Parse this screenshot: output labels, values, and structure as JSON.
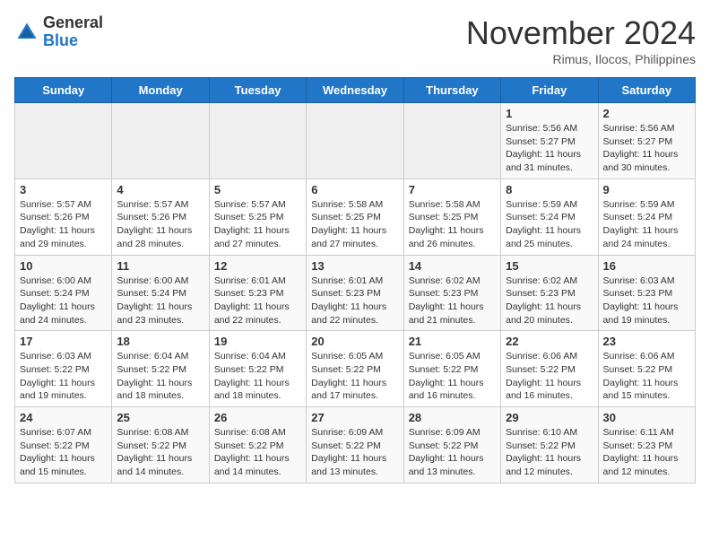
{
  "header": {
    "logo": {
      "general": "General",
      "blue": "Blue"
    },
    "month": "November 2024",
    "location": "Rimus, Ilocos, Philippines"
  },
  "weekdays": [
    "Sunday",
    "Monday",
    "Tuesday",
    "Wednesday",
    "Thursday",
    "Friday",
    "Saturday"
  ],
  "weeks": [
    [
      {
        "day": "",
        "sunrise": "",
        "sunset": "",
        "daylight": ""
      },
      {
        "day": "",
        "sunrise": "",
        "sunset": "",
        "daylight": ""
      },
      {
        "day": "",
        "sunrise": "",
        "sunset": "",
        "daylight": ""
      },
      {
        "day": "",
        "sunrise": "",
        "sunset": "",
        "daylight": ""
      },
      {
        "day": "",
        "sunrise": "",
        "sunset": "",
        "daylight": ""
      },
      {
        "day": "1",
        "sunrise": "Sunrise: 5:56 AM",
        "sunset": "Sunset: 5:27 PM",
        "daylight": "Daylight: 11 hours and 31 minutes."
      },
      {
        "day": "2",
        "sunrise": "Sunrise: 5:56 AM",
        "sunset": "Sunset: 5:27 PM",
        "daylight": "Daylight: 11 hours and 30 minutes."
      }
    ],
    [
      {
        "day": "3",
        "sunrise": "Sunrise: 5:57 AM",
        "sunset": "Sunset: 5:26 PM",
        "daylight": "Daylight: 11 hours and 29 minutes."
      },
      {
        "day": "4",
        "sunrise": "Sunrise: 5:57 AM",
        "sunset": "Sunset: 5:26 PM",
        "daylight": "Daylight: 11 hours and 28 minutes."
      },
      {
        "day": "5",
        "sunrise": "Sunrise: 5:57 AM",
        "sunset": "Sunset: 5:25 PM",
        "daylight": "Daylight: 11 hours and 27 minutes."
      },
      {
        "day": "6",
        "sunrise": "Sunrise: 5:58 AM",
        "sunset": "Sunset: 5:25 PM",
        "daylight": "Daylight: 11 hours and 27 minutes."
      },
      {
        "day": "7",
        "sunrise": "Sunrise: 5:58 AM",
        "sunset": "Sunset: 5:25 PM",
        "daylight": "Daylight: 11 hours and 26 minutes."
      },
      {
        "day": "8",
        "sunrise": "Sunrise: 5:59 AM",
        "sunset": "Sunset: 5:24 PM",
        "daylight": "Daylight: 11 hours and 25 minutes."
      },
      {
        "day": "9",
        "sunrise": "Sunrise: 5:59 AM",
        "sunset": "Sunset: 5:24 PM",
        "daylight": "Daylight: 11 hours and 24 minutes."
      }
    ],
    [
      {
        "day": "10",
        "sunrise": "Sunrise: 6:00 AM",
        "sunset": "Sunset: 5:24 PM",
        "daylight": "Daylight: 11 hours and 24 minutes."
      },
      {
        "day": "11",
        "sunrise": "Sunrise: 6:00 AM",
        "sunset": "Sunset: 5:24 PM",
        "daylight": "Daylight: 11 hours and 23 minutes."
      },
      {
        "day": "12",
        "sunrise": "Sunrise: 6:01 AM",
        "sunset": "Sunset: 5:23 PM",
        "daylight": "Daylight: 11 hours and 22 minutes."
      },
      {
        "day": "13",
        "sunrise": "Sunrise: 6:01 AM",
        "sunset": "Sunset: 5:23 PM",
        "daylight": "Daylight: 11 hours and 22 minutes."
      },
      {
        "day": "14",
        "sunrise": "Sunrise: 6:02 AM",
        "sunset": "Sunset: 5:23 PM",
        "daylight": "Daylight: 11 hours and 21 minutes."
      },
      {
        "day": "15",
        "sunrise": "Sunrise: 6:02 AM",
        "sunset": "Sunset: 5:23 PM",
        "daylight": "Daylight: 11 hours and 20 minutes."
      },
      {
        "day": "16",
        "sunrise": "Sunrise: 6:03 AM",
        "sunset": "Sunset: 5:23 PM",
        "daylight": "Daylight: 11 hours and 19 minutes."
      }
    ],
    [
      {
        "day": "17",
        "sunrise": "Sunrise: 6:03 AM",
        "sunset": "Sunset: 5:22 PM",
        "daylight": "Daylight: 11 hours and 19 minutes."
      },
      {
        "day": "18",
        "sunrise": "Sunrise: 6:04 AM",
        "sunset": "Sunset: 5:22 PM",
        "daylight": "Daylight: 11 hours and 18 minutes."
      },
      {
        "day": "19",
        "sunrise": "Sunrise: 6:04 AM",
        "sunset": "Sunset: 5:22 PM",
        "daylight": "Daylight: 11 hours and 18 minutes."
      },
      {
        "day": "20",
        "sunrise": "Sunrise: 6:05 AM",
        "sunset": "Sunset: 5:22 PM",
        "daylight": "Daylight: 11 hours and 17 minutes."
      },
      {
        "day": "21",
        "sunrise": "Sunrise: 6:05 AM",
        "sunset": "Sunset: 5:22 PM",
        "daylight": "Daylight: 11 hours and 16 minutes."
      },
      {
        "day": "22",
        "sunrise": "Sunrise: 6:06 AM",
        "sunset": "Sunset: 5:22 PM",
        "daylight": "Daylight: 11 hours and 16 minutes."
      },
      {
        "day": "23",
        "sunrise": "Sunrise: 6:06 AM",
        "sunset": "Sunset: 5:22 PM",
        "daylight": "Daylight: 11 hours and 15 minutes."
      }
    ],
    [
      {
        "day": "24",
        "sunrise": "Sunrise: 6:07 AM",
        "sunset": "Sunset: 5:22 PM",
        "daylight": "Daylight: 11 hours and 15 minutes."
      },
      {
        "day": "25",
        "sunrise": "Sunrise: 6:08 AM",
        "sunset": "Sunset: 5:22 PM",
        "daylight": "Daylight: 11 hours and 14 minutes."
      },
      {
        "day": "26",
        "sunrise": "Sunrise: 6:08 AM",
        "sunset": "Sunset: 5:22 PM",
        "daylight": "Daylight: 11 hours and 14 minutes."
      },
      {
        "day": "27",
        "sunrise": "Sunrise: 6:09 AM",
        "sunset": "Sunset: 5:22 PM",
        "daylight": "Daylight: 11 hours and 13 minutes."
      },
      {
        "day": "28",
        "sunrise": "Sunrise: 6:09 AM",
        "sunset": "Sunset: 5:22 PM",
        "daylight": "Daylight: 11 hours and 13 minutes."
      },
      {
        "day": "29",
        "sunrise": "Sunrise: 6:10 AM",
        "sunset": "Sunset: 5:22 PM",
        "daylight": "Daylight: 11 hours and 12 minutes."
      },
      {
        "day": "30",
        "sunrise": "Sunrise: 6:11 AM",
        "sunset": "Sunset: 5:23 PM",
        "daylight": "Daylight: 11 hours and 12 minutes."
      }
    ]
  ]
}
